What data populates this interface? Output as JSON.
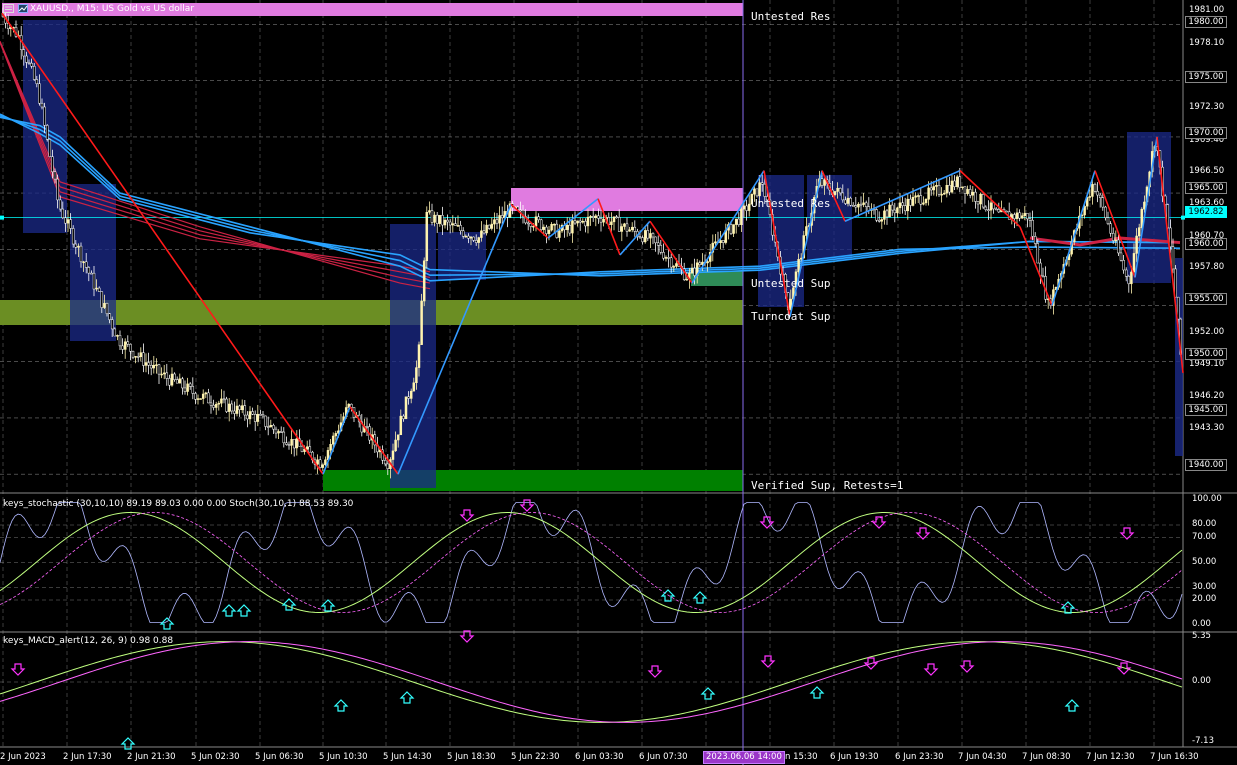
{
  "window": {
    "title": "XAUUSD., M15:  US Gold vs US dollar",
    "symbol_icon": "chart-window-icon",
    "menu_icon": "window-menu-icon"
  },
  "colors": {
    "background": "#000000",
    "grid": "#ffffff",
    "bull_candle": "#fff4b0",
    "bear_candle": "#ffffff",
    "resistance_zone": "#e07be0",
    "support_zone_verified": "#008000",
    "turncoat_zone": "#6b8e23",
    "untested_sup_zone": "#2e8b57",
    "highlight_box": "#1b2a8a",
    "zigzag_down": "#ff1a1a",
    "zigzag_up": "#3399ff",
    "ma_red": "#cc2244",
    "ma_blue": "#29a3ff",
    "hline": "#00ffff",
    "vline": "#8a6cf0",
    "arrow_down": "#ff33ff",
    "arrow_up": "#33ffff"
  },
  "zones": {
    "untested_res": "Untested Res",
    "untested_res_mid": "Untested Res",
    "untested_sup": "Untested Sup",
    "turncoat_sup": "Turncoat Sup",
    "verified_sup": "Verified Sup, Retests=1"
  },
  "price_axis": {
    "labels": [
      "1981.00",
      "1978.10",
      "1972.30",
      "1969.40",
      "1966.50",
      "1963.60",
      "1960.70",
      "1957.80",
      "1952.00",
      "1949.10",
      "1946.20",
      "1943.30"
    ],
    "boxed": [
      {
        "text": "1980.00",
        "kind": "level"
      },
      {
        "text": "1975.00",
        "kind": "level"
      },
      {
        "text": "1970.00",
        "kind": "level"
      },
      {
        "text": "1965.00",
        "kind": "level"
      },
      {
        "text": "1962.82",
        "kind": "current"
      },
      {
        "text": "1960.00",
        "kind": "level"
      },
      {
        "text": "1955.00",
        "kind": "level"
      },
      {
        "text": "1950.00",
        "kind": "level"
      },
      {
        "text": "1945.00",
        "kind": "level"
      },
      {
        "text": "1940.00",
        "kind": "level"
      }
    ]
  },
  "stochastic": {
    "title": "keys_stochastic (30,10,10) 89.19 89.03 0.00 0.00 Stoch(30,10,1) 88.53 89.30",
    "axis": [
      "100.00",
      "80.00",
      "70.00",
      "50.00",
      "30.00",
      "20.00",
      "0.00"
    ]
  },
  "macd": {
    "title": "keys_MACD_alert(12, 26, 9) 0.98 0.88",
    "axis": [
      "5.35",
      "0.00",
      "-7.13"
    ]
  },
  "time_axis": {
    "labels": [
      "2 Jun 2023",
      "2 Jun 17:30",
      "2 Jun 21:30",
      "5 Jun 02:30",
      "5 Jun 06:30",
      "5 Jun 10:30",
      "5 Jun 14:30",
      "5 Jun 18:30",
      "5 Jun 22:30",
      "6 Jun 03:30",
      "6 Jun 07:30",
      "n 15:30",
      "6 Jun 19:30",
      "6 Jun 23:30",
      "7 Jun 04:30",
      "7 Jun 08:30",
      "7 Jun 12:30",
      "7 Jun 16:30"
    ],
    "cursor": "2023.06.06 14:00"
  },
  "chart_data": {
    "type": "candlestick",
    "symbol": "XAUUSD.",
    "timeframe": "M15",
    "price_range": [
      1939.0,
      1982.0
    ],
    "current_price": 1962.82,
    "resistance_zones": [
      [
        1980.0,
        1982.0
      ],
      [
        1962.0,
        1965.2
      ]
    ],
    "support_zones": [
      [
        1952.3,
        1955.2
      ],
      [
        1938.9,
        1940.7
      ],
      [
        1956.3,
        1957.3
      ]
    ],
    "zigzag_points": [
      1981.0,
      1940.0,
      1946.0,
      1940.0,
      1964.0,
      1961.0,
      1964.5,
      1959.5,
      1962.5,
      1957.0,
      1967.0,
      1954.0,
      1967.0,
      1962.5,
      1967.0,
      1962.0,
      1955.0,
      1967.0,
      1957.5,
      1970.0,
      1949.0
    ],
    "ma_values_start": [
      1970.5,
      1971.0,
      1971.5,
      1972.0
    ],
    "ma_values_mid": [
      1956.5,
      1957.0,
      1957.5,
      1958.0
    ],
    "ma_values_end": [
      1960.5,
      1961.0,
      1961.0,
      1961.0
    ],
    "stochastic_range": [
      0,
      100
    ],
    "stoch_values": [
      89.19,
      89.03,
      0.0,
      0.0
    ],
    "stoch_values_2": [
      88.53,
      89.3
    ],
    "macd_range": [
      -7.13,
      5.35
    ],
    "macd_values": [
      0.98,
      0.88
    ],
    "stoch_levels": [
      80,
      70,
      50,
      30,
      20
    ]
  }
}
